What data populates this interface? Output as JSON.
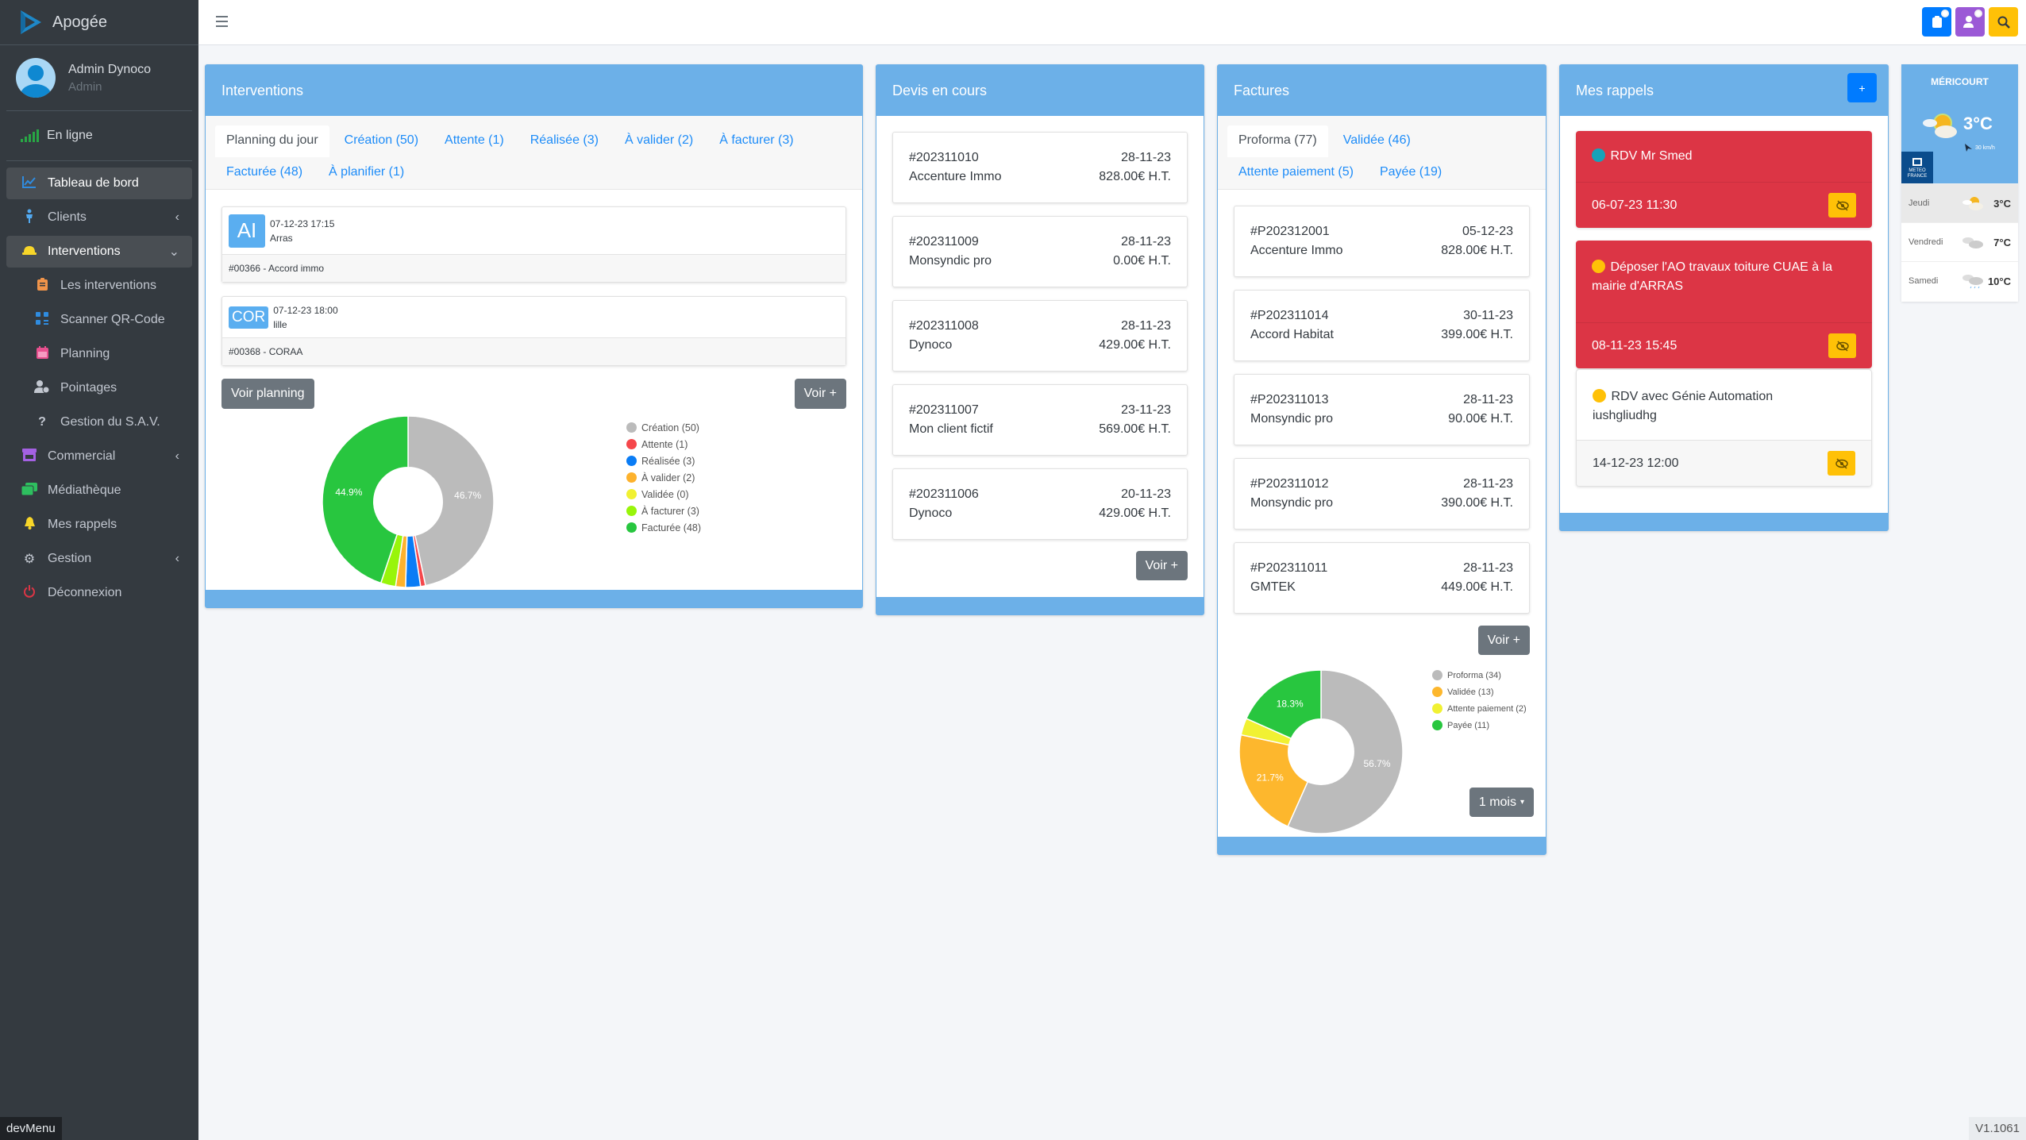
{
  "app": {
    "name": "Apogée"
  },
  "user": {
    "name": "Admin Dynoco",
    "role": "Admin"
  },
  "status": {
    "label": "En ligne"
  },
  "sidebar": {
    "items": [
      {
        "label": "Tableau de bord",
        "icon": "chart-line-icon"
      },
      {
        "label": "Clients",
        "icon": "person-icon"
      },
      {
        "label": "Interventions",
        "icon": "hard-hat-icon"
      },
      {
        "label": "Les interventions",
        "icon": "clipboard-icon"
      },
      {
        "label": "Scanner QR-Code",
        "icon": "qrcode-icon"
      },
      {
        "label": "Planning",
        "icon": "calendar-icon"
      },
      {
        "label": "Pointages",
        "icon": "user-clock-icon"
      },
      {
        "label": "Gestion du S.A.V.",
        "icon": "question-icon"
      },
      {
        "label": "Commercial",
        "icon": "store-icon"
      },
      {
        "label": "Médiathèque",
        "icon": "images-icon"
      },
      {
        "label": "Mes rappels",
        "icon": "bell-icon"
      },
      {
        "label": "Gestion",
        "icon": "cogs-icon"
      },
      {
        "label": "Déconnexion",
        "icon": "power-icon"
      }
    ],
    "devmenu": "devMenu"
  },
  "topbar": {
    "buttons": [
      {
        "name": "clipboard-notifications",
        "color": "#007bff"
      },
      {
        "name": "user-notifications",
        "color": "#9b59d6"
      },
      {
        "name": "search",
        "color": "#ffc107"
      }
    ]
  },
  "interventions": {
    "title": "Interventions",
    "tabs": [
      {
        "label": "Planning du jour",
        "active": true
      },
      {
        "label": "Création (50)"
      },
      {
        "label": "Attente (1)"
      },
      {
        "label": "Réalisée (3)"
      },
      {
        "label": "À valider (2)"
      },
      {
        "label": "À facturer (3)"
      },
      {
        "label": "Facturée (48)"
      },
      {
        "label": "À planifier (1)"
      }
    ],
    "items": [
      {
        "initials": "AI",
        "datetime": "07-12-23 17:15",
        "city": "Arras",
        "ref": "#00366 - Accord immo"
      },
      {
        "initials": "COR",
        "datetime": "07-12-23 18:00",
        "city": "lille",
        "ref": "#00368 - CORAA"
      }
    ],
    "btn_planning": "Voir planning",
    "btn_more": "Voir +"
  },
  "devis": {
    "title": "Devis en cours",
    "items": [
      {
        "num": "#202311010",
        "client": "Accenture Immo",
        "date": "28-11-23",
        "amount": "828.00€ H.T."
      },
      {
        "num": "#202311009",
        "client": "Monsyndic pro",
        "date": "28-11-23",
        "amount": "0.00€ H.T."
      },
      {
        "num": "#202311008",
        "client": "Dynoco",
        "date": "28-11-23",
        "amount": "429.00€ H.T."
      },
      {
        "num": "#202311007",
        "client": "Mon client fictif",
        "date": "23-11-23",
        "amount": "569.00€ H.T."
      },
      {
        "num": "#202311006",
        "client": "Dynoco",
        "date": "20-11-23",
        "amount": "429.00€ H.T."
      }
    ],
    "btn_more": "Voir +"
  },
  "factures": {
    "title": "Factures",
    "tabs": [
      {
        "label": "Proforma (77)",
        "active": true
      },
      {
        "label": "Validée (46)"
      },
      {
        "label": "Attente paiement (5)"
      },
      {
        "label": "Payée (19)"
      }
    ],
    "items": [
      {
        "num": "#P202312001",
        "client": "Accenture Immo",
        "date": "05-12-23",
        "amount": "828.00€ H.T."
      },
      {
        "num": "#P202311014",
        "client": "Accord Habitat",
        "date": "30-11-23",
        "amount": "399.00€ H.T."
      },
      {
        "num": "#P202311013",
        "client": "Monsyndic pro",
        "date": "28-11-23",
        "amount": "90.00€ H.T."
      },
      {
        "num": "#P202311012",
        "client": "Monsyndic pro",
        "date": "28-11-23",
        "amount": "390.00€ H.T."
      },
      {
        "num": "#P202311011",
        "client": "GMTEK",
        "date": "28-11-23",
        "amount": "449.00€ H.T."
      }
    ],
    "btn_more": "Voir +",
    "period": "1 mois"
  },
  "rappels": {
    "title": "Mes rappels",
    "add_label": "+",
    "items": [
      {
        "text": "RDV Mr Smed",
        "datetime": "06-07-23 11:30",
        "style": "red",
        "bullet": "#17a2b8"
      },
      {
        "text": "Déposer l'AO travaux toiture CUAE à la mairie d'ARRAS",
        "datetime": "08-11-23 15:45",
        "style": "red",
        "bullet": "#ffc107"
      },
      {
        "text": "RDV avec Génie Automation iushgliudhg",
        "datetime": "14-12-23 12:00",
        "style": "white",
        "bullet": "#ffc107"
      }
    ]
  },
  "weather": {
    "city": "MÉRICOURT",
    "temp": "3°C",
    "wind": "30 km/h",
    "provider": "METEO FRANCE",
    "forecast": [
      {
        "day": "Jeudi",
        "temp": "3°C",
        "icon": "sun-cloud-icon"
      },
      {
        "day": "Vendredi",
        "temp": "7°C",
        "icon": "cloud-icon"
      },
      {
        "day": "Samedi",
        "temp": "10°C",
        "icon": "rain-cloud-icon"
      }
    ]
  },
  "version": "V1.1061",
  "chart_data": [
    {
      "type": "pie",
      "title": "Interventions",
      "categories": [
        "Création (50)",
        "Attente (1)",
        "Réalisée (3)",
        "À valider (2)",
        "Validée (0)",
        "À facturer (3)",
        "Facturée (48)"
      ],
      "values": [
        50,
        1,
        3,
        2,
        0,
        3,
        48
      ],
      "colors": [
        "#bbbbbb",
        "#f5474b",
        "#0a7cf5",
        "#fdb22d",
        "#f1f132",
        "#98f50a",
        "#28c63f"
      ],
      "data_labels": {
        "0": "46.7%",
        "6": "44.9%"
      },
      "legend": "right"
    },
    {
      "type": "pie",
      "title": "Factures",
      "categories": [
        "Proforma (34)",
        "Validée (13)",
        "Attente paiement (2)",
        "Payée (11)"
      ],
      "values": [
        34,
        13,
        2,
        11
      ],
      "colors": [
        "#bbbbbb",
        "#fdb72d",
        "#f1f132",
        "#28c63f"
      ],
      "data_labels": {
        "0": "56.7%",
        "1": "21.7%",
        "3": "18.3%"
      },
      "legend": "right"
    }
  ]
}
